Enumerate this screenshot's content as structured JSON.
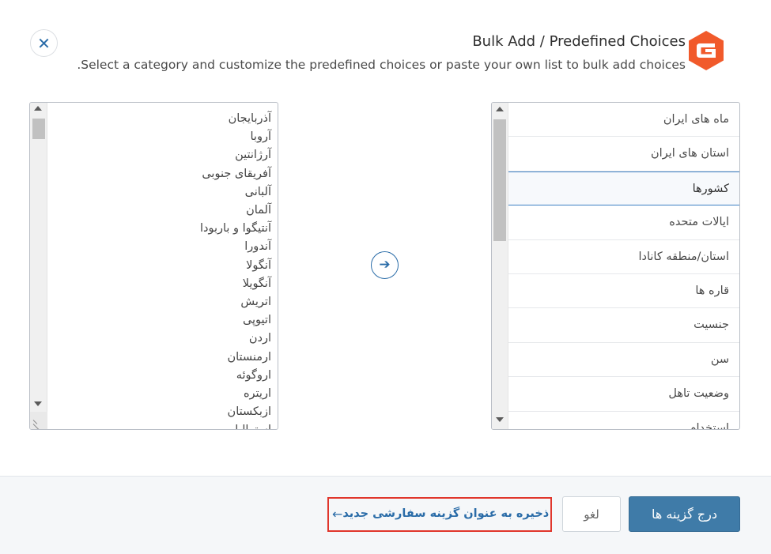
{
  "header": {
    "title": "Bulk Add / Predefined Choices",
    "subtitle": ".Select a category and customize the predefined choices or paste your own list to bulk add choices"
  },
  "icons": {
    "close": "close-icon",
    "logo": "gravity-forms-logo",
    "arrow": "arrow-right-icon"
  },
  "choices": [
    "آذربایجان",
    "آروبا",
    "آرژانتین",
    "آفریقای جنوبی",
    "آلبانی",
    "آلمان",
    "آنتیگوا و باربودا",
    "آندورا",
    "آنگولا",
    "آنگویلا",
    "اتریش",
    "اتیوپی",
    "اردن",
    "ارمنستان",
    "اروگوئه",
    "اریتره",
    "ازبکستان",
    "استرالیا"
  ],
  "categories": [
    {
      "label": "ماه های ایران",
      "active": false
    },
    {
      "label": "استان های ایران",
      "active": false
    },
    {
      "label": "کشورها",
      "active": true
    },
    {
      "label": "ایالات متحده",
      "active": false
    },
    {
      "label": "استان/منطقه کانادا",
      "active": false
    },
    {
      "label": "قاره ها",
      "active": false
    },
    {
      "label": "جنسیت",
      "active": false
    },
    {
      "label": "سن",
      "active": false
    },
    {
      "label": "وضعیت تاهل",
      "active": false
    },
    {
      "label": "استخدام",
      "active": false
    }
  ],
  "footer": {
    "insert_label": "درج گزینه ها",
    "cancel_label": "لغو",
    "save_label": "ذخیره به عنوان گزینه سفارشی جدید",
    "save_arrow": "←"
  },
  "colors": {
    "accent": "#2a6ca8",
    "primary_button": "#3f7ba8",
    "highlight": "#e0362c",
    "logo": "#f15a2b"
  }
}
